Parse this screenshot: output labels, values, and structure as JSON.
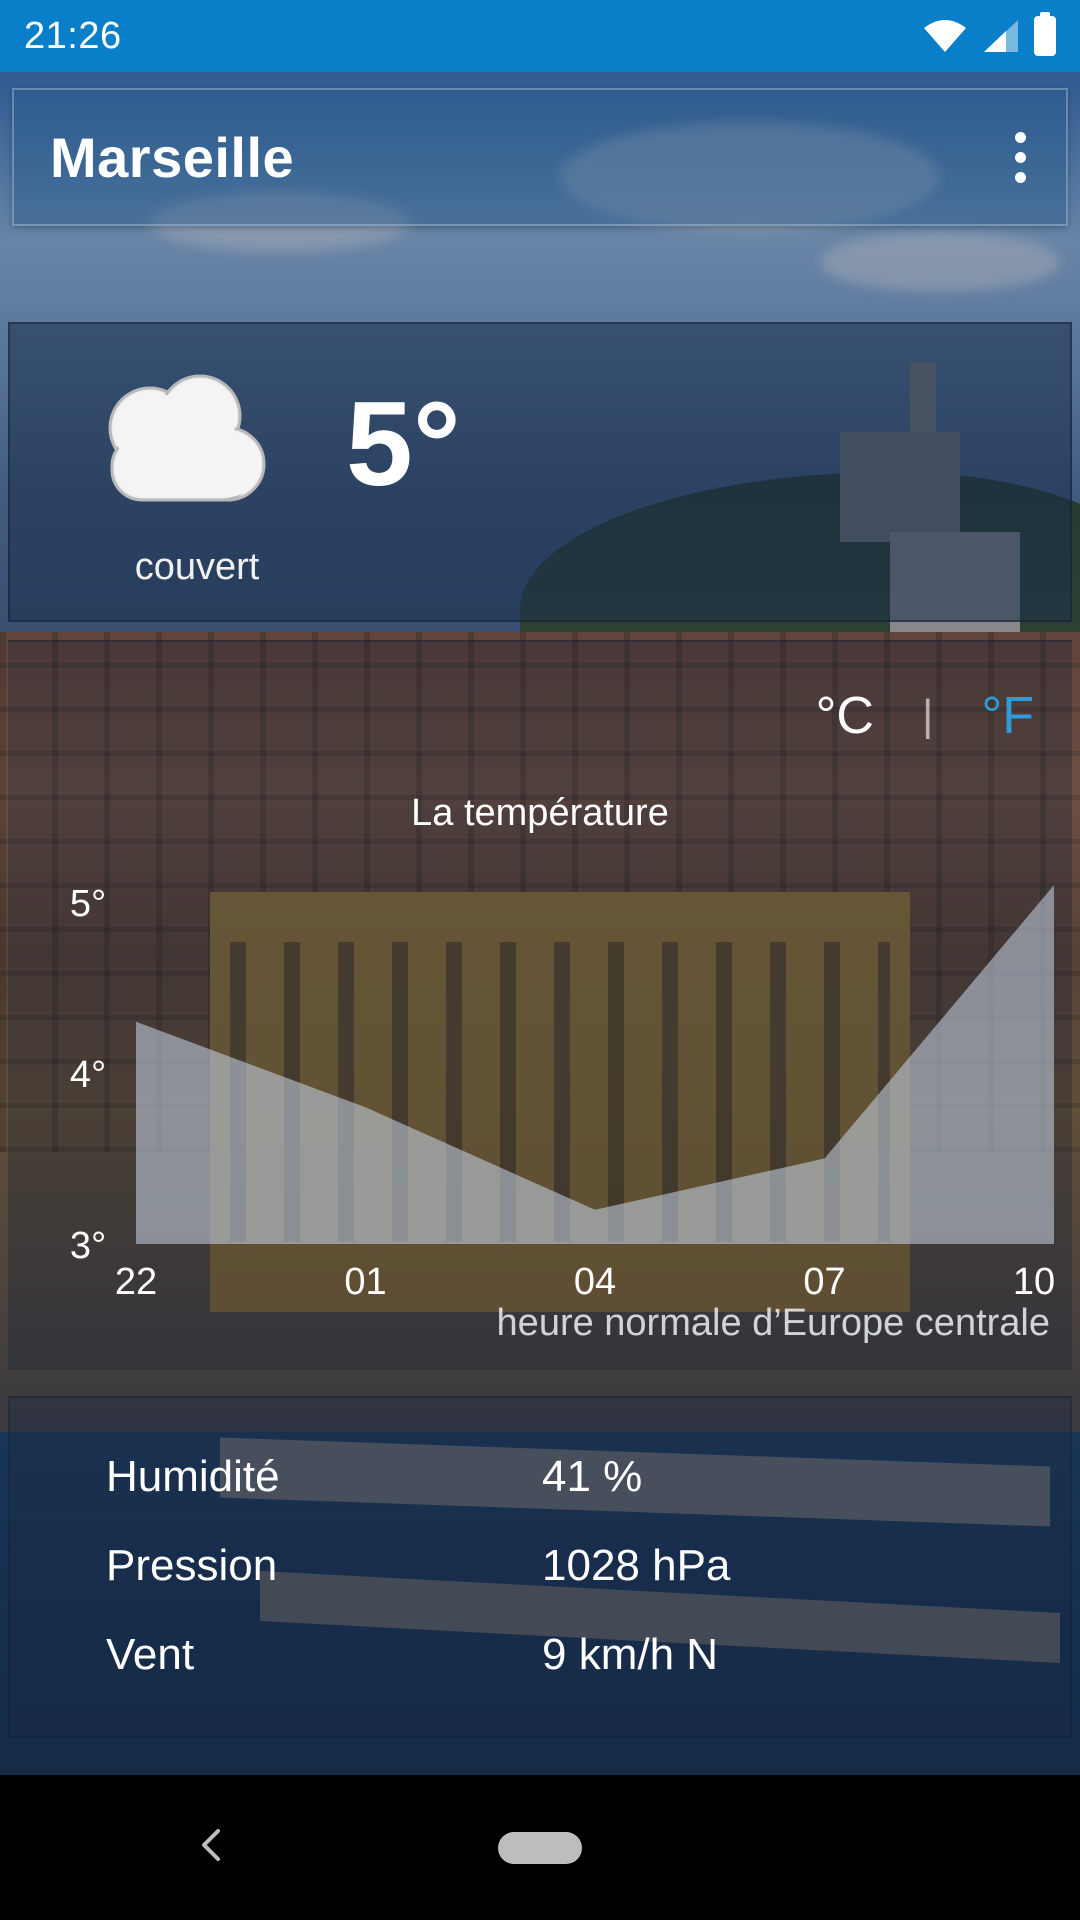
{
  "status_bar": {
    "time": "21:26",
    "icons": [
      "wifi-icon",
      "signal-icon",
      "battery-icon"
    ]
  },
  "app_bar": {
    "title": "Marseille",
    "menu_icon": "more-vert-icon"
  },
  "current": {
    "condition": "couvert",
    "temperature": "5°",
    "icon": "cloud-icon"
  },
  "units": {
    "celsius": "°C",
    "separator": "|",
    "fahrenheit": "°F",
    "selected_color": "#ffffff",
    "inactive_color": "#2f9bd8"
  },
  "chart_data": {
    "type": "area",
    "title": "La température",
    "x": [
      "22",
      "01",
      "04",
      "07",
      "10"
    ],
    "values": [
      4.3,
      3.8,
      3.2,
      3.5,
      5.1
    ],
    "y_ticks": [
      "5°",
      "4°",
      "3°"
    ],
    "ylim": [
      3,
      5.2
    ],
    "xlabel": "heure normale d’Europe centrale",
    "fill_color": "#c9d7ea"
  },
  "details": [
    {
      "label": "Humidité",
      "value": "41 %"
    },
    {
      "label": "Pression",
      "value": "1028 hPa"
    },
    {
      "label": "Vent",
      "value": "9 km/h N"
    }
  ],
  "nav": {
    "back_icon": "back-icon",
    "home_icon": "home-pill-icon"
  }
}
